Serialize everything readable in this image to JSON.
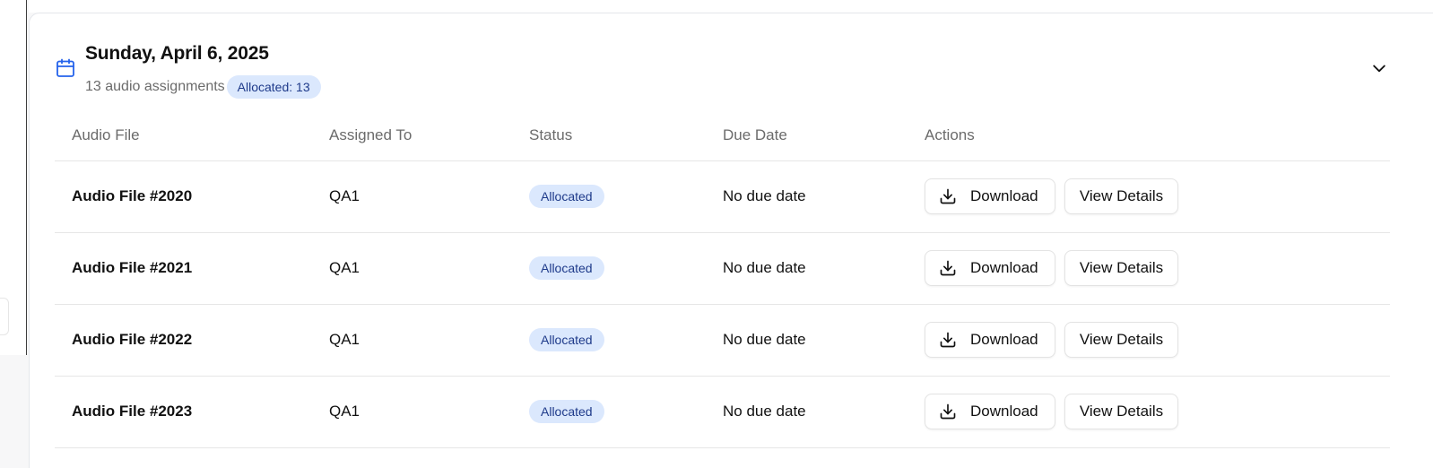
{
  "group": {
    "title": "Sunday, April 6, 2025",
    "count_text": "13 audio assignments",
    "badge": "Allocated: 13",
    "icon": "calendar-icon",
    "collapse_icon": "chevron-down-icon"
  },
  "table": {
    "columns": [
      "Audio File",
      "Assigned To",
      "Status",
      "Due Date",
      "Actions"
    ],
    "rows": [
      {
        "file": "Audio File #2020",
        "assignee": "QA1",
        "status": "Allocated",
        "due": "No due date",
        "download_label": "Download",
        "view_label": "View Details"
      },
      {
        "file": "Audio File #2021",
        "assignee": "QA1",
        "status": "Allocated",
        "due": "No due date",
        "download_label": "Download",
        "view_label": "View Details"
      },
      {
        "file": "Audio File #2022",
        "assignee": "QA1",
        "status": "Allocated",
        "due": "No due date",
        "download_label": "Download",
        "view_label": "View Details"
      },
      {
        "file": "Audio File #2023",
        "assignee": "QA1",
        "status": "Allocated",
        "due": "No due date",
        "download_label": "Download",
        "view_label": "View Details"
      }
    ]
  },
  "colors": {
    "accent": "#2563eb",
    "badge_bg": "#dbe8fd",
    "badge_text": "#1e3a8a",
    "muted_text": "#6b6b6b",
    "border": "#e6e6e6"
  }
}
